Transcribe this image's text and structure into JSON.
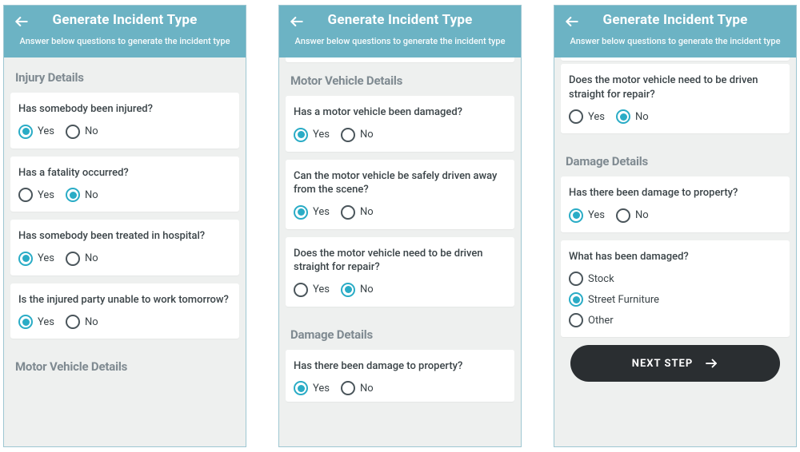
{
  "header": {
    "title": "Generate Incident Type",
    "subtitle": "Answer below questions to generate the incident type"
  },
  "labels": {
    "yes": "Yes",
    "no": "No",
    "next_step": "NEXT STEP"
  },
  "sections": {
    "injury": "Injury Details",
    "motor": "Motor Vehicle Details",
    "damage": "Damage Details"
  },
  "questions": {
    "injured": "Has somebody been injured?",
    "fatality": "Has a fatality occurred?",
    "hospital": "Has somebody been treated in hospital?",
    "unable_work": "Is the injured party unable to work tomorrow?",
    "mv_damaged": "Has a motor vehicle been damaged?",
    "mv_safe_drive": "Can the motor vehicle be safely driven away from the scene?",
    "mv_repair": "Does the motor vehicle need to be driven straight for repair?",
    "prop_damage": "Has there been damage to property?",
    "what_damaged": "What has been damaged?"
  },
  "damage_options": {
    "stock": "Stock",
    "street_furniture": "Street Furniture",
    "other": "Other"
  }
}
